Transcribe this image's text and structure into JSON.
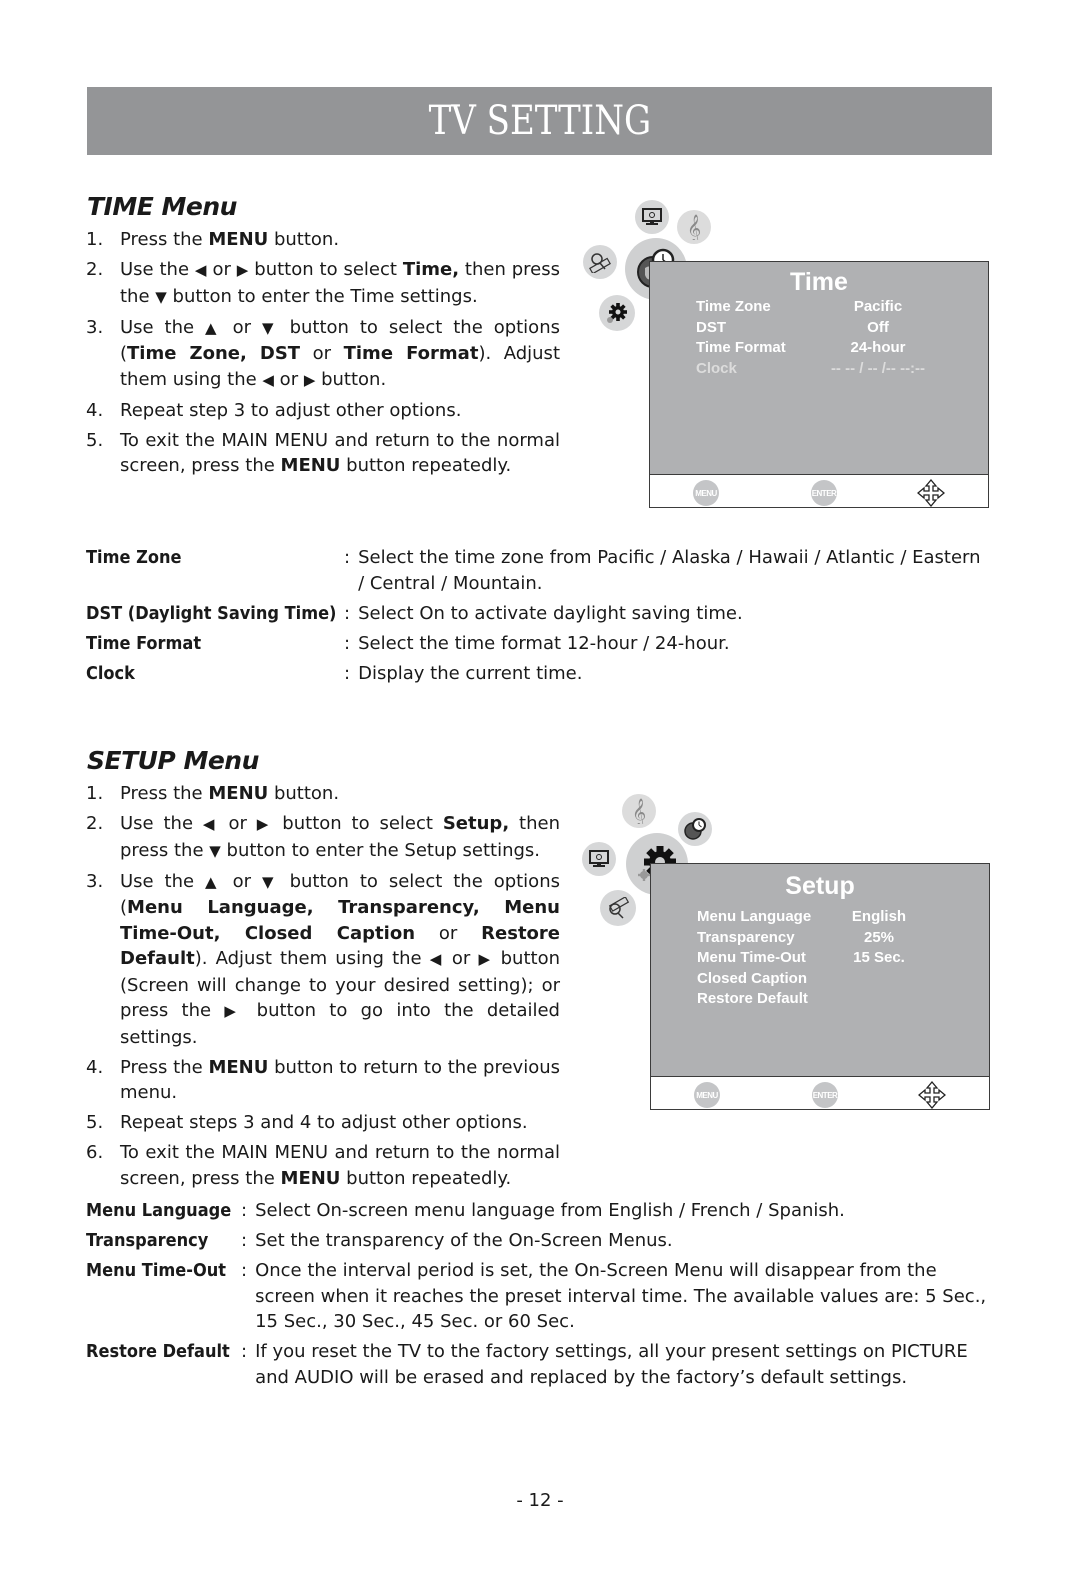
{
  "header": {
    "title": "TV SETTING"
  },
  "time_section": {
    "title": "TIME Menu",
    "steps": [
      {
        "num": "1.",
        "parts": [
          [
            "Press the ",
            false
          ],
          [
            "MENU",
            true
          ],
          [
            " button.",
            false
          ]
        ]
      },
      {
        "num": "2.",
        "parts": [
          [
            "Use the ",
            false
          ],
          [
            "◀",
            false
          ],
          [
            " or ",
            false
          ],
          [
            "▶",
            false
          ],
          [
            " button to select ",
            false
          ],
          [
            "Time,",
            true
          ],
          [
            " then press the ",
            false
          ],
          [
            "▼",
            false
          ],
          [
            " button to enter the Time settings.",
            false
          ]
        ]
      },
      {
        "num": "3.",
        "parts": [
          [
            "Use the ",
            false
          ],
          [
            "▲",
            false
          ],
          [
            " or ",
            false
          ],
          [
            "▼",
            false
          ],
          [
            " button to select the options (",
            false
          ],
          [
            "Time Zone, DST",
            true
          ],
          [
            " or ",
            false
          ],
          [
            "Time Format",
            true
          ],
          [
            "). Adjust them using the ",
            false
          ],
          [
            "◀",
            false
          ],
          [
            " or ",
            false
          ],
          [
            "▶",
            false
          ],
          [
            " button.",
            false
          ]
        ]
      },
      {
        "num": "4.",
        "parts": [
          [
            "Repeat step 3 to adjust other options.",
            false
          ]
        ]
      },
      {
        "num": "5.",
        "parts": [
          [
            "To exit the MAIN MENU and return to the normal screen, press the ",
            false
          ],
          [
            "MENU",
            true
          ],
          [
            " button repeatedly.",
            false
          ]
        ]
      }
    ],
    "definitions": [
      {
        "term": "Time Zone",
        "desc": "Select the time zone from Pacific / Alaska / Hawaii / Atlantic / Eastern / Central / Mountain."
      },
      {
        "term": "DST (Daylight Saving Time)",
        "desc": "Select On to activate daylight saving time."
      },
      {
        "term": "Time Format",
        "desc": "Select the time format 12-hour / 24-hour."
      },
      {
        "term": "Clock",
        "desc": "Display the current time."
      }
    ],
    "osd": {
      "title": "Time",
      "rows": [
        {
          "label": "Time Zone",
          "value": "Pacific",
          "dim": false
        },
        {
          "label": "DST",
          "value": "Off",
          "dim": false
        },
        {
          "label": "Time Format",
          "value": "24-hour",
          "dim": false
        },
        {
          "label": "Clock",
          "value": "-- -- / -- /--   --:--",
          "dim": true
        }
      ],
      "footer": {
        "menu": "MENU",
        "enter": "ENTER"
      },
      "icons": [
        "picture-icon",
        "audio-icon",
        "channel-icon",
        "time-icon",
        "setup-icon"
      ],
      "selected_icon": "time-icon"
    }
  },
  "setup_section": {
    "title": "SETUP Menu",
    "steps": [
      {
        "num": "1.",
        "parts": [
          [
            "Press the ",
            false
          ],
          [
            "MENU",
            true
          ],
          [
            " button.",
            false
          ]
        ]
      },
      {
        "num": "2.",
        "parts": [
          [
            "Use the ",
            false
          ],
          [
            "◀",
            false
          ],
          [
            " or ",
            false
          ],
          [
            "▶",
            false
          ],
          [
            " button to select ",
            false
          ],
          [
            "Setup,",
            true
          ],
          [
            " then press the ",
            false
          ],
          [
            "▼",
            false
          ],
          [
            " button to enter the Setup settings.",
            false
          ]
        ]
      },
      {
        "num": "3.",
        "parts": [
          [
            "Use the ",
            false
          ],
          [
            "▲",
            false
          ],
          [
            " or ",
            false
          ],
          [
            "▼",
            false
          ],
          [
            " button to select the options (",
            false
          ],
          [
            "Menu Language, Transparency, Menu Time-Out, Closed Caption",
            true
          ],
          [
            " or ",
            false
          ],
          [
            "Restore Default",
            true
          ],
          [
            "). Adjust them using the ",
            false
          ],
          [
            "◀",
            false
          ],
          [
            " or ",
            false
          ],
          [
            "▶",
            false
          ],
          [
            " button (Screen will change to your desired setting); or press the ",
            false
          ],
          [
            "▶",
            false
          ],
          [
            " button to go into the detailed settings.",
            false
          ]
        ]
      },
      {
        "num": "4.",
        "parts": [
          [
            "Press the ",
            false
          ],
          [
            "MENU",
            true
          ],
          [
            " button to return to the previous menu.",
            false
          ]
        ]
      },
      {
        "num": "5.",
        "parts": [
          [
            "Repeat steps 3 and 4 to adjust other options.",
            false
          ]
        ]
      },
      {
        "num": "6.",
        "parts": [
          [
            "To exit the MAIN MENU and return to the normal screen, press the ",
            false
          ],
          [
            "MENU",
            true
          ],
          [
            " button repeatedly.",
            false
          ]
        ]
      }
    ],
    "definitions": [
      {
        "term": "Menu Language",
        "desc": "Select On-screen menu language from English / French / Spanish."
      },
      {
        "term": "Transparency",
        "desc": "Set the transparency of the On-Screen Menus."
      },
      {
        "term": "Menu Time-Out",
        "desc": "Once the interval period is set, the On-Screen Menu will disappear from the screen when it reaches the preset interval time. The available values are: 5 Sec., 15 Sec., 30 Sec., 45 Sec. or 60 Sec."
      },
      {
        "term": "Restore Default",
        "desc": "If you reset the TV to the factory settings, all your present settings on PICTURE and AUDIO will be erased and replaced by the factory’s default settings."
      }
    ],
    "osd": {
      "title": "Setup",
      "rows": [
        {
          "label": "Menu  Language",
          "value": "English",
          "dim": false
        },
        {
          "label": "Transparency",
          "value": "25%",
          "dim": false
        },
        {
          "label": "Menu Time-Out",
          "value": "15 Sec.",
          "dim": false
        },
        {
          "label": "Closed  Caption",
          "value": "",
          "dim": false
        },
        {
          "label": "Restore  Default",
          "value": "",
          "dim": false
        }
      ],
      "footer": {
        "menu": "MENU",
        "enter": "ENTER"
      },
      "icons": [
        "audio-icon",
        "time-icon",
        "picture-icon",
        "setup-icon",
        "channel-icon"
      ],
      "selected_icon": "setup-icon"
    }
  },
  "page_number": "- 12 -",
  "colors": {
    "banner": "#949597",
    "osd_screen": "#b0b1b3",
    "osd_icon_bg": "#d6d7d8"
  }
}
